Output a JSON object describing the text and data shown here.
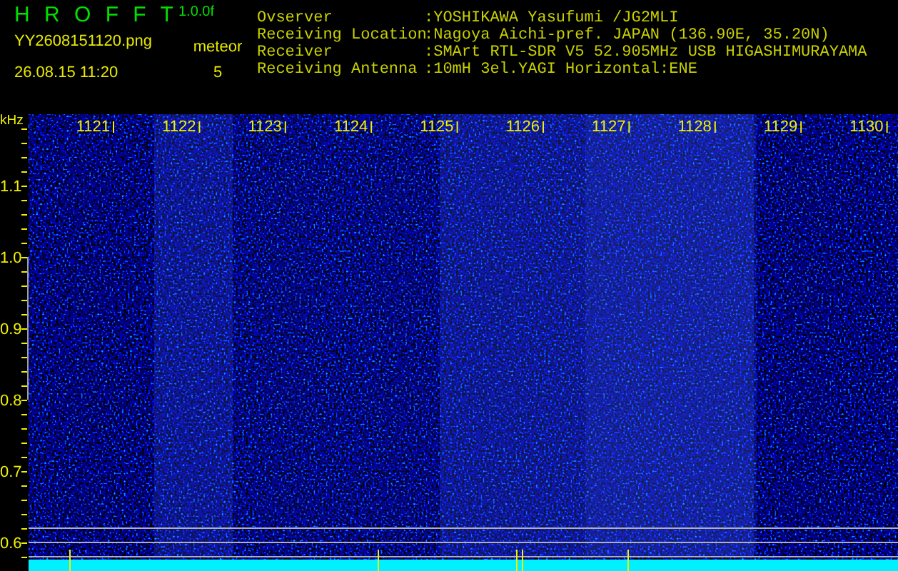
{
  "header": {
    "title": "H R O F F T",
    "version": "1.0.0f",
    "filename": "YY2608151120.png",
    "meteor_label": "meteor",
    "datetime": "26.08.15 11:20",
    "meteor_count": "5"
  },
  "station": [
    {
      "label": "Ovserver",
      "value": ":YOSHIKAWA Yasufumi /JG2MLI"
    },
    {
      "label": "Receiving Location",
      "value": ":Nagoya Aichi-pref. JAPAN (136.90E, 35.20N)"
    },
    {
      "label": "Receiver",
      "value": ":SMArt RTL-SDR V5 52.905MHz USB HIGASHIMURAYAMA"
    },
    {
      "label": "Receiving Antenna",
      "value": ":10mH 3el.YAGI Horizontal:ENE"
    }
  ],
  "spectrogram": {
    "y_unit": "kHz",
    "x_labels": [
      "1121",
      "1122",
      "1123",
      "1124",
      "1125",
      "1126",
      "1127",
      "1128",
      "1129",
      "1130"
    ],
    "y_labels": [
      "1.1",
      "1.0",
      "0.9",
      "0.8",
      "0.7",
      "0.6"
    ]
  }
}
